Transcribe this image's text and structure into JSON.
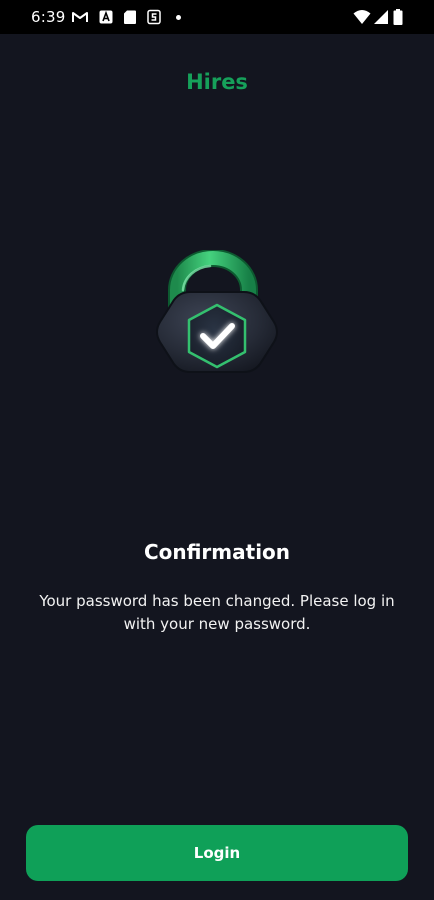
{
  "status_bar": {
    "time": "6:39",
    "notification_icons": [
      "gmail-icon",
      "app-a-icon",
      "sd-card-icon",
      "s-app-icon"
    ],
    "right_icons": [
      "wifi-icon",
      "signal-icon",
      "battery-icon"
    ]
  },
  "header": {
    "title": "Hires"
  },
  "illustration": {
    "icon": "lock-check-icon"
  },
  "confirmation": {
    "title": "Confirmation",
    "message": "Your password has been changed. Please log in with your new password."
  },
  "actions": {
    "login_label": "Login"
  },
  "colors": {
    "background": "#13151f",
    "accent": "#0fa058",
    "title_accent": "#16a05a",
    "status_bar": "#000000"
  }
}
